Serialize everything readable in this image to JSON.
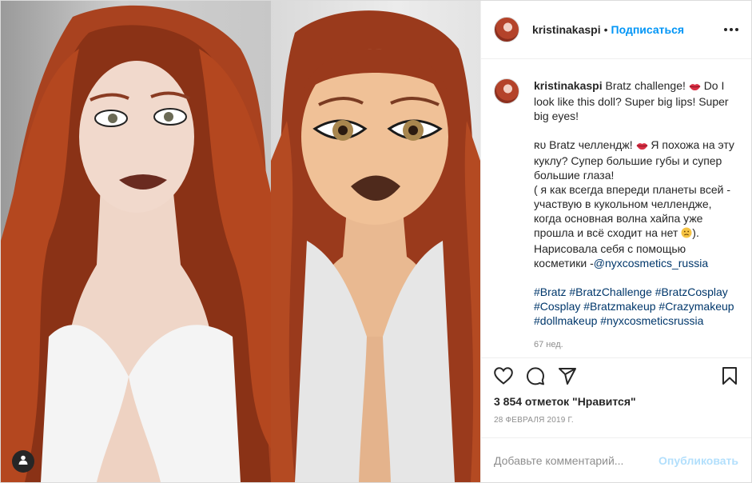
{
  "header": {
    "username": "kristinakaspi",
    "separator": "•",
    "follow_label": "Подписаться"
  },
  "caption": {
    "username": "kristinakaspi",
    "line1": "Bratz challenge!",
    "line1b": "Do I look like this doll? Super big lips! Super big eyes!",
    "ru_prefix": "ʀᴜ",
    "ru_text1": "Bratz челлендж!",
    "ru_text2": "Я похожа на эту куклу? Супер большие губы и супер большие глаза!",
    "ru_text3": "( я как всегда впереди планеты всей - участвую в кукольном челлендже, когда основная волна хайпа уже прошла и всё сходит на нет",
    "ru_text3_end": ").",
    "ru_text4": "Нарисовала себя с помощью косметики -",
    "mention": "@nyxcosmetics_russia",
    "hashtags": "#Bratz #BratzChallenge #BratzCosplay #Cosplay #Bratzmakeup #Crazymakeup #dollmakeup #nyxcosmeticsrussia",
    "ago": "67 нед."
  },
  "icons": {
    "like": "heart-icon",
    "comment": "comment-icon",
    "share": "paper-plane-icon",
    "save": "bookmark-icon",
    "more": "more-options-icon",
    "tagged_users": "user-icon",
    "lips": "lips-emoji",
    "face": "slightly-frowning-face-emoji"
  },
  "likes_text": "3 854 отметок \"Нравится\"",
  "date_text": "28 февраля 2019 г.",
  "comment_box": {
    "placeholder": "Добавьте комментарий...",
    "post_label": "Опубликовать"
  },
  "colors": {
    "accent": "#0095f6",
    "post_disabled": "#b2dffc",
    "hashtag": "#00376b"
  }
}
